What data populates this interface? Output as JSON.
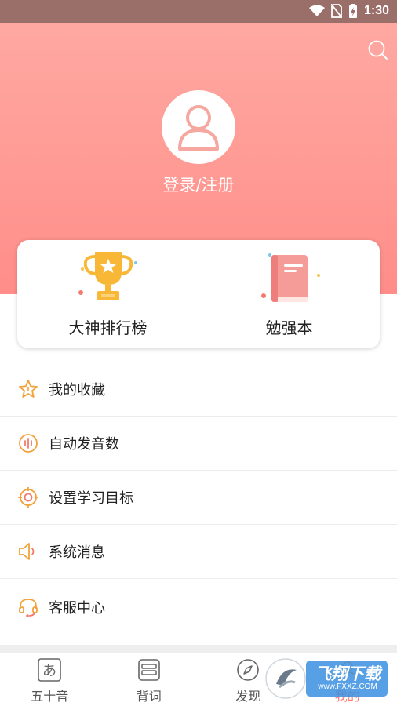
{
  "status_bar": {
    "time": "1:30"
  },
  "header": {
    "login_label": "登录/注册"
  },
  "cards": [
    {
      "label": "大神排行榜",
      "icon": "trophy-icon"
    },
    {
      "label": "勉强本",
      "icon": "notebook-icon"
    }
  ],
  "menu": [
    {
      "label": "我的收藏",
      "icon": "star-icon"
    },
    {
      "label": "自动发音数",
      "icon": "audio-wave-icon"
    },
    {
      "label": "设置学习目标",
      "icon": "target-icon"
    },
    {
      "label": "系统消息",
      "icon": "speaker-icon"
    },
    {
      "label": "客服中心",
      "icon": "headset-icon"
    }
  ],
  "tabs": [
    {
      "label": "五十音",
      "icon": "kana-a-icon"
    },
    {
      "label": "背词",
      "icon": "card-stack-icon"
    },
    {
      "label": "发现",
      "icon": "compass-icon"
    },
    {
      "label": "我的",
      "icon": "profile-icon",
      "active": true
    }
  ],
  "watermark": {
    "text": "飞翔下载",
    "url_text": "www.FXXZ.COM"
  },
  "colors": {
    "accent": "#ff8d89",
    "icon_orange": "#f2a23b",
    "header_top": "#ffa8a2"
  }
}
